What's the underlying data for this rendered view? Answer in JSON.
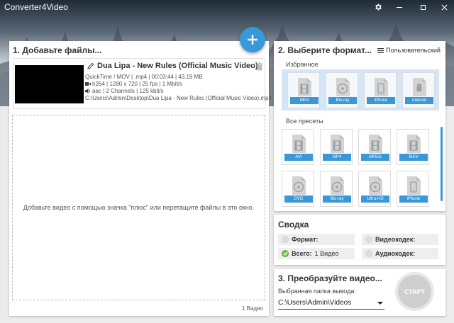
{
  "window": {
    "title": "Converter4Video"
  },
  "step1": {
    "title": "1. Добавьте файлы...",
    "file": {
      "name": "Dua Lipa - New Rules (Official Music Video)",
      "container": "QuickTime / MOV | .mp4 | 00:03:44 | 43.19 MB",
      "video": "h264 | 1280 x 720 | 25 fps | 1 Mbit/s",
      "audio": "aac | 2 Channels | 125 kbit/s",
      "path": "C:\\Users\\Admin\\Desktop\\Dua Lipa - New Rules (Official Music Video).mp4"
    },
    "drop_hint": "Добавьте видео с помощью значка \"плюс\" или перетащите файлы в это окно.",
    "count": "1 Видео"
  },
  "step2": {
    "title": "2. Выберите формат...",
    "custom_label": "Пользовательский",
    "favorites_label": "Избранное",
    "favorites": [
      {
        "label": "MP4",
        "icon": "film-icon"
      },
      {
        "label": "Blu-ray",
        "icon": "disc-icon"
      },
      {
        "label": "iPhone",
        "icon": "phone-icon"
      },
      {
        "label": "Android",
        "icon": "android-icon"
      }
    ],
    "all_presets_label": "Все пресеты",
    "presets": [
      {
        "label": "AVI",
        "icon": "film-icon"
      },
      {
        "label": "MP4",
        "icon": "film-icon"
      },
      {
        "label": "MPEG",
        "icon": "film-icon"
      },
      {
        "label": "MKV",
        "icon": "film-icon"
      },
      {
        "label": "DVD",
        "icon": "disc-icon"
      },
      {
        "label": "Blu-ray",
        "icon": "disc-icon"
      },
      {
        "label": "Ultra-HD",
        "icon": "disc-icon"
      },
      {
        "label": "iPhone",
        "icon": "phone-icon"
      }
    ]
  },
  "summary": {
    "title": "Сводка",
    "format_label": "Формат:",
    "video_codec_label": "Видеокодек:",
    "total_label": "Всего:",
    "total_value": "1 Видео",
    "audio_codec_label": "Аудиокодек:"
  },
  "step3": {
    "title": "3. Преобразуйте видео...",
    "output_label": "Выбранная папка вывода:",
    "output_value": "C:\\Users\\Admin\\Videos",
    "start_label": "СТАРТ"
  },
  "colors": {
    "accent": "#3a97d8",
    "ok": "#6fbf56"
  }
}
